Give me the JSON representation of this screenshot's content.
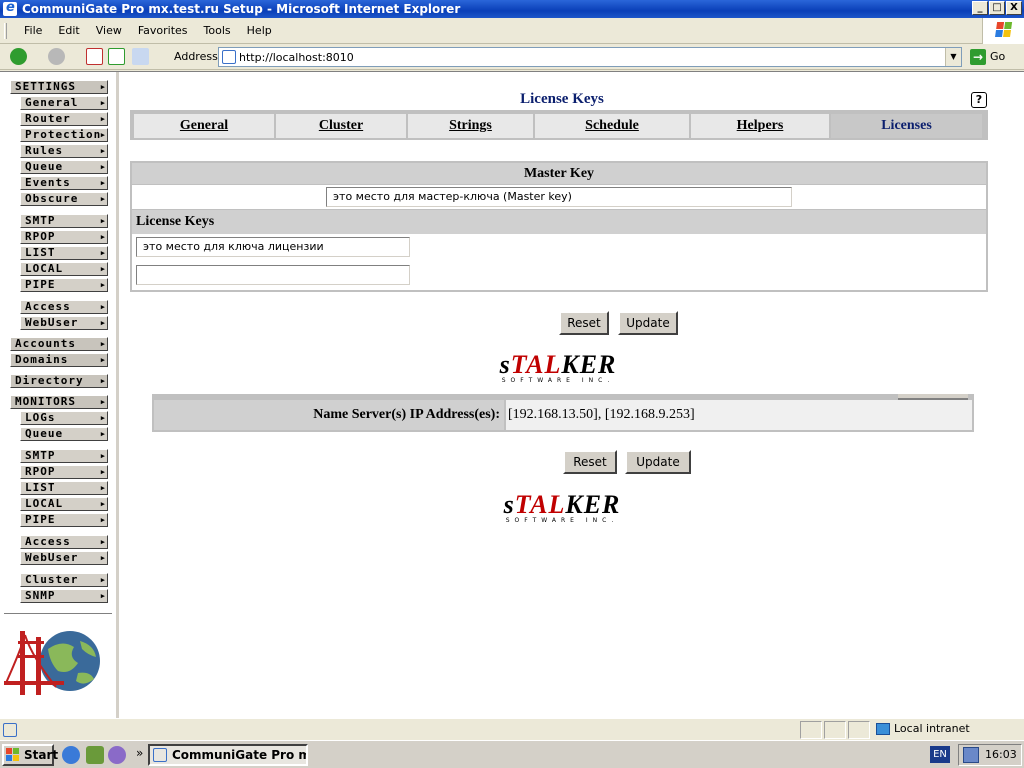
{
  "window": {
    "title": "CommuniGate Pro mx.test.ru Setup - Microsoft Internet Explorer",
    "controls": {
      "minimize": "_",
      "maximize": "□",
      "close": "X"
    }
  },
  "menu": [
    "File",
    "Edit",
    "View",
    "Favorites",
    "Tools",
    "Help"
  ],
  "address_bar": {
    "label": "Address",
    "url": "http://localhost:8010",
    "go_label": "Go"
  },
  "sidebar": {
    "sections": [
      {
        "label": "SETTINGS",
        "items": [
          "General",
          "Router",
          "Protection",
          "Rules",
          "Queue",
          "Events",
          "Obscure",
          "SMTP",
          "RPOP",
          "LIST",
          "LOCAL",
          "PIPE",
          "Access",
          "WebUser"
        ]
      },
      {
        "label": "Accounts",
        "items": []
      },
      {
        "label": "Domains",
        "items": []
      },
      {
        "label": "Directory",
        "items": []
      },
      {
        "label": "MONITORS",
        "items": [
          "LOGs",
          "Queue",
          "SMTP",
          "RPOP",
          "LIST",
          "LOCAL",
          "PIPE",
          "Access",
          "WebUser",
          "Cluster",
          "SNMP"
        ]
      }
    ]
  },
  "page": {
    "title": "License Keys",
    "help_icon": "?",
    "tabs": [
      "General",
      "Cluster",
      "Strings",
      "Schedule",
      "Helpers",
      "Licenses"
    ],
    "active_tab": "Licenses"
  },
  "master_key": {
    "header": "Master Key",
    "value": "это место для мастер-ключа (Master key)"
  },
  "license_keys": {
    "header": "License Keys",
    "values": [
      "это место для ключа лицензии",
      ""
    ]
  },
  "buttons": {
    "reset": "Reset",
    "update": "Update"
  },
  "logo": {
    "word_left": "s",
    "word_red": "TAL",
    "word_right": "KER",
    "sub": "SOFTWARE INC."
  },
  "name_server": {
    "label": "Name Server(s) IP Address(es):",
    "value": "[192.168.13.50], [192.168.9.253]"
  },
  "status": {
    "zone": "Local intranet"
  },
  "taskbar": {
    "start": "Start",
    "chevron": "»",
    "task": "CommuniGate Pro mx...",
    "lang": "EN",
    "clock": "16:03"
  },
  "colors": {
    "title_blue": "#0b1f6e",
    "logo_red": "#c00000",
    "xp_blue": "#0a3fb8"
  }
}
